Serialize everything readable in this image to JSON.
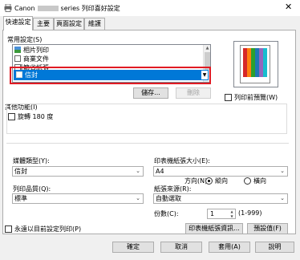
{
  "window": {
    "brand": "Canon",
    "title_suffix": "series 列印喜好設定",
    "close_label": "✕"
  },
  "tabs": [
    {
      "label": "快速設定",
      "active": true
    },
    {
      "label": "主要"
    },
    {
      "label": "頁面設定"
    },
    {
      "label": "維護"
    }
  ],
  "common_settings": {
    "label": "常用設定(S)",
    "items": [
      {
        "label": "相片列印"
      },
      {
        "label": "商業文件"
      },
      {
        "label": "節省紙張"
      }
    ],
    "selected": "信封",
    "save_button": "儲存...",
    "delete_button": "刪除"
  },
  "preview": {
    "checkbox_label": "列印前預覽(W)"
  },
  "other_features": {
    "label": "其他功能(I)",
    "rotate_label": "旋轉 180 度"
  },
  "media_type": {
    "label": "媒體類型(Y):",
    "value": "信封"
  },
  "print_quality": {
    "label": "列印品質(Q):",
    "value": "標準"
  },
  "printer_paper_size": {
    "label": "印表機紙張大小(E):",
    "value": "A4"
  },
  "orientation": {
    "label": "方向(N):",
    "portrait": "縱向",
    "landscape": "橫向"
  },
  "paper_source": {
    "label": "紙張來源(R):",
    "value": "自動選取"
  },
  "copies": {
    "label": "份數(C):",
    "value": "1",
    "range": "(1-999)"
  },
  "always_print": {
    "label": "永遠以目前設定列印(P)"
  },
  "buttons": {
    "printer_paper_info": "印表機紙張資訊...",
    "defaults": "預設值(F)",
    "ok": "確定",
    "cancel": "取消",
    "apply": "套用(A)",
    "help": "說明"
  }
}
